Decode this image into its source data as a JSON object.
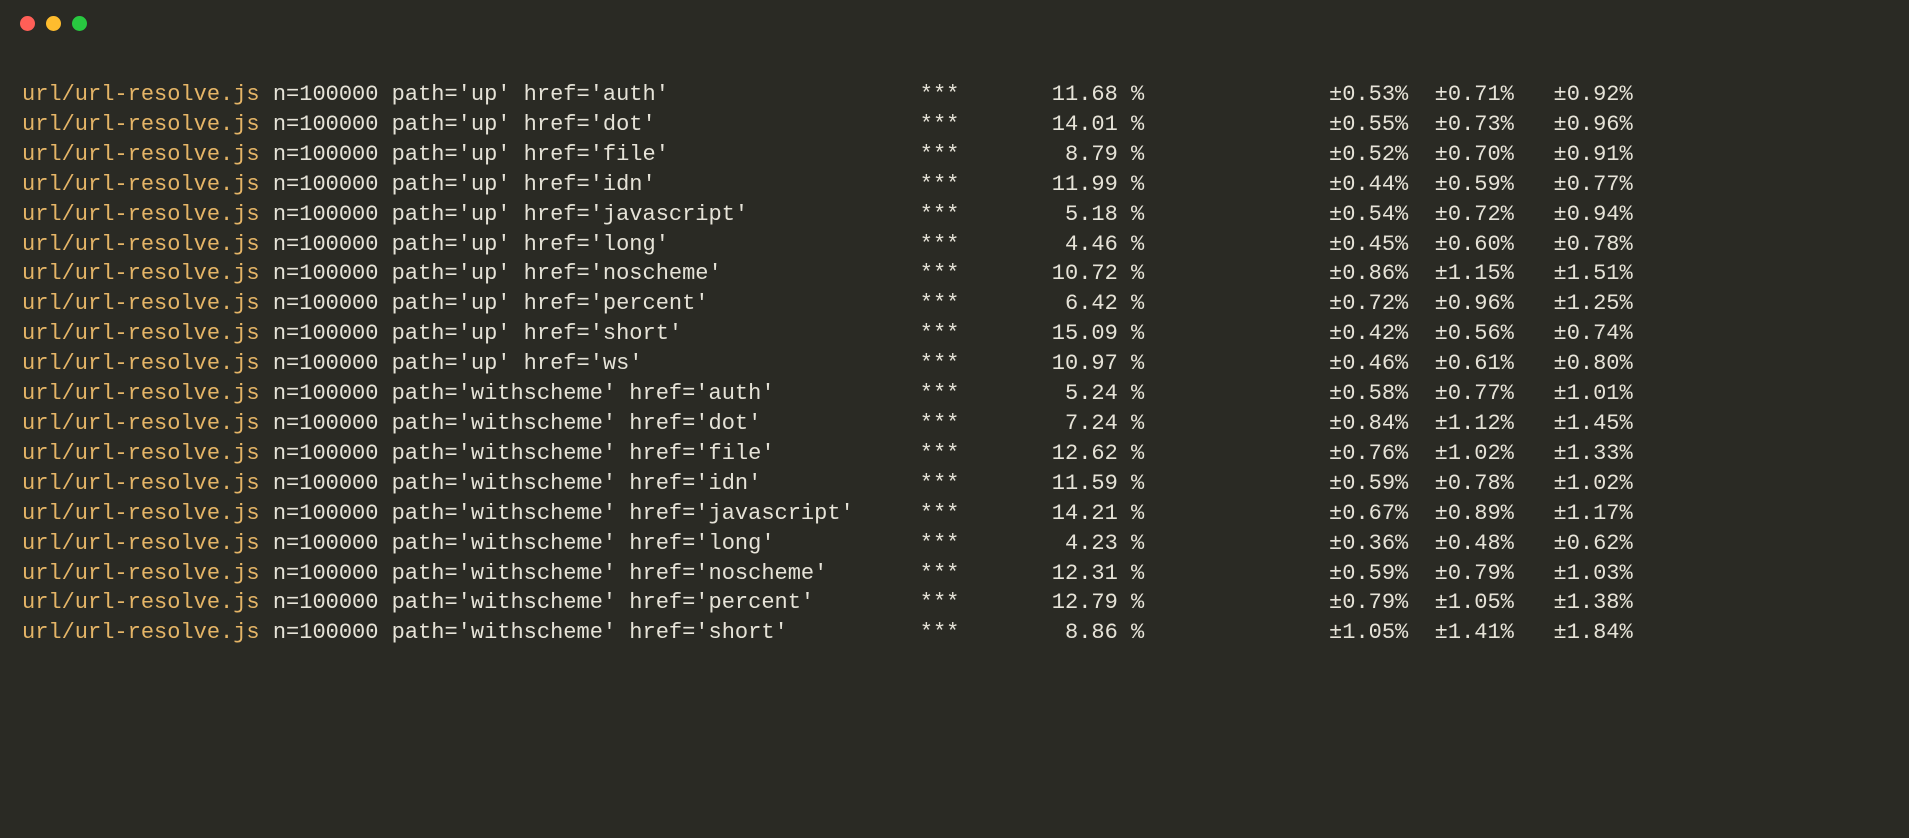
{
  "file": "url/url-resolve.js",
  "n": 100000,
  "stars": "***",
  "rows": [
    {
      "path": "up",
      "href": "auth",
      "percent": "11.68",
      "ci1": "±0.53%",
      "ci2": "±0.71%",
      "ci3": "±0.92%"
    },
    {
      "path": "up",
      "href": "dot",
      "percent": "14.01",
      "ci1": "±0.55%",
      "ci2": "±0.73%",
      "ci3": "±0.96%"
    },
    {
      "path": "up",
      "href": "file",
      "percent": "8.79",
      "ci1": "±0.52%",
      "ci2": "±0.70%",
      "ci3": "±0.91%"
    },
    {
      "path": "up",
      "href": "idn",
      "percent": "11.99",
      "ci1": "±0.44%",
      "ci2": "±0.59%",
      "ci3": "±0.77%"
    },
    {
      "path": "up",
      "href": "javascript",
      "percent": "5.18",
      "ci1": "±0.54%",
      "ci2": "±0.72%",
      "ci3": "±0.94%"
    },
    {
      "path": "up",
      "href": "long",
      "percent": "4.46",
      "ci1": "±0.45%",
      "ci2": "±0.60%",
      "ci3": "±0.78%"
    },
    {
      "path": "up",
      "href": "noscheme",
      "percent": "10.72",
      "ci1": "±0.86%",
      "ci2": "±1.15%",
      "ci3": "±1.51%"
    },
    {
      "path": "up",
      "href": "percent",
      "percent": "6.42",
      "ci1": "±0.72%",
      "ci2": "±0.96%",
      "ci3": "±1.25%"
    },
    {
      "path": "up",
      "href": "short",
      "percent": "15.09",
      "ci1": "±0.42%",
      "ci2": "±0.56%",
      "ci3": "±0.74%"
    },
    {
      "path": "up",
      "href": "ws",
      "percent": "10.97",
      "ci1": "±0.46%",
      "ci2": "±0.61%",
      "ci3": "±0.80%"
    },
    {
      "path": "withscheme",
      "href": "auth",
      "percent": "5.24",
      "ci1": "±0.58%",
      "ci2": "±0.77%",
      "ci3": "±1.01%"
    },
    {
      "path": "withscheme",
      "href": "dot",
      "percent": "7.24",
      "ci1": "±0.84%",
      "ci2": "±1.12%",
      "ci3": "±1.45%"
    },
    {
      "path": "withscheme",
      "href": "file",
      "percent": "12.62",
      "ci1": "±0.76%",
      "ci2": "±1.02%",
      "ci3": "±1.33%"
    },
    {
      "path": "withscheme",
      "href": "idn",
      "percent": "11.59",
      "ci1": "±0.59%",
      "ci2": "±0.78%",
      "ci3": "±1.02%"
    },
    {
      "path": "withscheme",
      "href": "javascript",
      "percent": "14.21",
      "ci1": "±0.67%",
      "ci2": "±0.89%",
      "ci3": "±1.17%"
    },
    {
      "path": "withscheme",
      "href": "long",
      "percent": "4.23",
      "ci1": "±0.36%",
      "ci2": "±0.48%",
      "ci3": "±0.62%"
    },
    {
      "path": "withscheme",
      "href": "noscheme",
      "percent": "12.31",
      "ci1": "±0.59%",
      "ci2": "±0.79%",
      "ci3": "±1.03%"
    },
    {
      "path": "withscheme",
      "href": "percent",
      "percent": "12.79",
      "ci1": "±0.79%",
      "ci2": "±1.05%",
      "ci3": "±1.38%"
    },
    {
      "path": "withscheme",
      "href": "short",
      "percent": "8.86",
      "ci1": "±1.05%",
      "ci2": "±1.41%",
      "ci3": "±1.84%"
    }
  ]
}
